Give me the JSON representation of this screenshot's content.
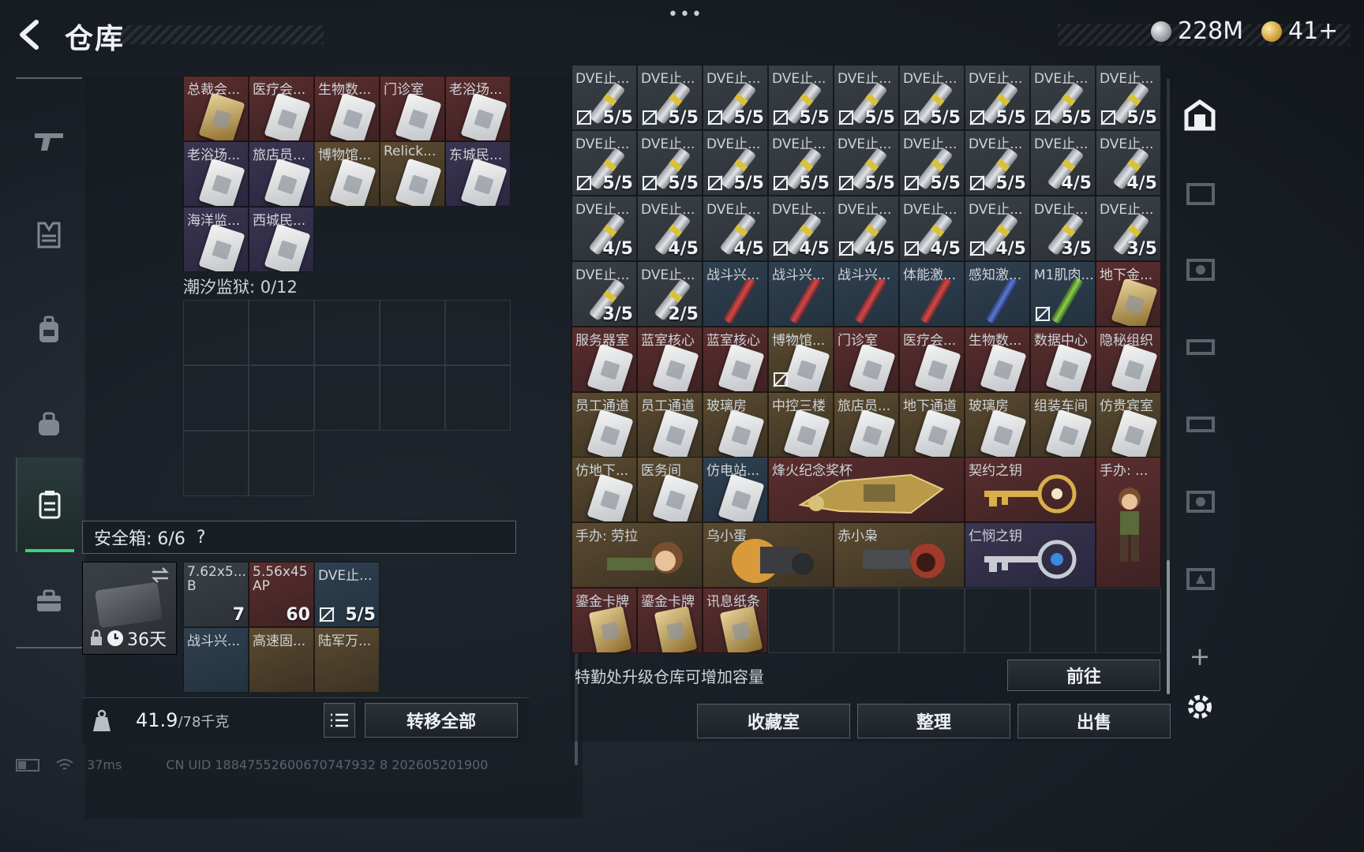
{
  "header": {
    "title": "仓库",
    "dots": "•••",
    "currency_silver": "228M",
    "currency_gold": "41+"
  },
  "left_nav": [
    "weapon-icon",
    "armor-icon",
    "backpack-icon",
    "bag-icon",
    "storage-icon",
    "briefcase-icon"
  ],
  "left_grid_top": [
    {
      "label": "总裁会...",
      "bg": "red",
      "item": "keycard-gold"
    },
    {
      "label": "医疗会...",
      "bg": "red",
      "item": "keycard"
    },
    {
      "label": "生物数...",
      "bg": "red",
      "item": "keycard"
    },
    {
      "label": "门诊室",
      "bg": "red",
      "item": "keycard"
    },
    {
      "label": "老浴场...",
      "bg": "red",
      "item": "keycard"
    },
    {
      "label": "老浴场...",
      "bg": "purple",
      "item": "keycard"
    },
    {
      "label": "旅店员...",
      "bg": "purple",
      "item": "keycard"
    },
    {
      "label": "博物馆...",
      "bg": "gold",
      "item": "keycard"
    },
    {
      "label": "Relick...",
      "bg": "gold",
      "item": "keycard"
    },
    {
      "label": "东城民...",
      "bg": "purple",
      "item": "keycard"
    },
    {
      "label": "海洋监...",
      "bg": "purple",
      "item": "keycard"
    },
    {
      "label": "西城民...",
      "bg": "purple",
      "item": "keycard"
    }
  ],
  "tide_prison_label": "潮汐监狱: 0/12",
  "safe_box": {
    "label": "安全箱: 6/6",
    "help": "?",
    "days": "36天",
    "items": [
      {
        "label": "7.62x5...",
        "sub": "B",
        "count": "7",
        "bg": "gray"
      },
      {
        "label": "5.56x45",
        "sub": "AP",
        "count": "60",
        "bg": "red"
      },
      {
        "label": "DVE止...",
        "count": "5/5",
        "bg": "blue",
        "bound": true
      },
      {
        "label": "战斗兴...",
        "count": "",
        "bg": "blue"
      },
      {
        "label": "高速固...",
        "count": "",
        "bg": "gold"
      },
      {
        "label": "陆军万...",
        "count": "",
        "bg": "gold"
      }
    ]
  },
  "weight": {
    "value": "41.9",
    "max": "/78千克"
  },
  "buttons": {
    "transfer_all": "转移全部",
    "goto": "前往",
    "collection": "收藏室",
    "sort": "整理",
    "sell": "出售"
  },
  "hint": "特勤处升级仓库可增加容量",
  "right_grid": [
    {
      "label": "DVE止...",
      "count": "5/5",
      "bg": "gray",
      "item": "injector",
      "bound": true
    },
    {
      "label": "DVE止...",
      "count": "5/5",
      "bg": "gray",
      "item": "injector",
      "bound": true
    },
    {
      "label": "DVE止...",
      "count": "5/5",
      "bg": "gray",
      "item": "injector",
      "bound": true
    },
    {
      "label": "DVE止...",
      "count": "5/5",
      "bg": "gray",
      "item": "injector",
      "bound": true
    },
    {
      "label": "DVE止...",
      "count": "5/5",
      "bg": "gray",
      "item": "injector",
      "bound": true
    },
    {
      "label": "DVE止...",
      "count": "5/5",
      "bg": "gray",
      "item": "injector",
      "bound": true
    },
    {
      "label": "DVE止...",
      "count": "5/5",
      "bg": "gray",
      "item": "injector",
      "bound": true
    },
    {
      "label": "DVE止...",
      "count": "5/5",
      "bg": "gray",
      "item": "injector",
      "bound": true
    },
    {
      "label": "DVE止...",
      "count": "5/5",
      "bg": "gray",
      "item": "injector",
      "bound": true
    },
    {
      "label": "DVE止...",
      "count": "5/5",
      "bg": "gray",
      "item": "injector",
      "bound": true
    },
    {
      "label": "DVE止...",
      "count": "5/5",
      "bg": "gray",
      "item": "injector",
      "bound": true
    },
    {
      "label": "DVE止...",
      "count": "5/5",
      "bg": "gray",
      "item": "injector",
      "bound": true
    },
    {
      "label": "DVE止...",
      "count": "5/5",
      "bg": "gray",
      "item": "injector",
      "bound": true
    },
    {
      "label": "DVE止...",
      "count": "5/5",
      "bg": "gray",
      "item": "injector",
      "bound": true
    },
    {
      "label": "DVE止...",
      "count": "5/5",
      "bg": "gray",
      "item": "injector",
      "bound": true
    },
    {
      "label": "DVE止...",
      "count": "5/5",
      "bg": "gray",
      "item": "injector",
      "bound": true
    },
    {
      "label": "DVE止...",
      "count": "4/5",
      "bg": "gray",
      "item": "injector",
      "bound": false
    },
    {
      "label": "DVE止...",
      "count": "4/5",
      "bg": "gray",
      "item": "injector",
      "bound": false
    },
    {
      "label": "DVE止...",
      "count": "4/5",
      "bg": "gray",
      "item": "injector",
      "bound": false
    },
    {
      "label": "DVE止...",
      "count": "4/5",
      "bg": "gray",
      "item": "injector",
      "bound": false
    },
    {
      "label": "DVE止...",
      "count": "4/5",
      "bg": "gray",
      "item": "injector",
      "bound": false
    },
    {
      "label": "DVE止...",
      "count": "4/5",
      "bg": "gray",
      "item": "injector",
      "bound": true
    },
    {
      "label": "DVE止...",
      "count": "4/5",
      "bg": "gray",
      "item": "injector",
      "bound": true
    },
    {
      "label": "DVE止...",
      "count": "4/5",
      "bg": "gray",
      "item": "injector",
      "bound": true
    },
    {
      "label": "DVE止...",
      "count": "4/5",
      "bg": "gray",
      "item": "injector",
      "bound": true
    },
    {
      "label": "DVE止...",
      "count": "3/5",
      "bg": "gray",
      "item": "injector",
      "bound": false
    },
    {
      "label": "DVE止...",
      "count": "3/5",
      "bg": "gray",
      "item": "injector",
      "bound": false
    },
    {
      "label": "DVE止...",
      "count": "3/5",
      "bg": "gray",
      "item": "injector",
      "bound": false
    },
    {
      "label": "DVE止...",
      "count": "2/5",
      "bg": "gray",
      "item": "injector",
      "bound": false
    },
    {
      "label": "战斗兴...",
      "count": "",
      "bg": "blue",
      "item": "stim"
    },
    {
      "label": "战斗兴...",
      "count": "",
      "bg": "blue",
      "item": "stim"
    },
    {
      "label": "战斗兴...",
      "count": "",
      "bg": "blue",
      "item": "stim"
    },
    {
      "label": "体能激...",
      "count": "",
      "bg": "blue",
      "item": "stim"
    },
    {
      "label": "感知激...",
      "count": "",
      "bg": "blue",
      "item": "stim-blue"
    },
    {
      "label": "M1肌肉...",
      "count": "",
      "bg": "blue",
      "item": "stim-green",
      "bound": true
    },
    {
      "label": "地下金...",
      "count": "",
      "bg": "red",
      "item": "keycard-gold"
    },
    {
      "label": "服务器室",
      "count": "",
      "bg": "red",
      "item": "keycard"
    },
    {
      "label": "蓝室核心",
      "count": "",
      "bg": "red",
      "item": "keycard"
    },
    {
      "label": "蓝室核心",
      "count": "",
      "bg": "red",
      "item": "keycard"
    },
    {
      "label": "博物馆...",
      "count": "",
      "bg": "gold",
      "item": "keycard",
      "bound": true
    },
    {
      "label": "门诊室",
      "count": "",
      "bg": "red",
      "item": "keycard"
    },
    {
      "label": "医疗会...",
      "count": "",
      "bg": "red",
      "item": "keycard"
    },
    {
      "label": "生物数...",
      "count": "",
      "bg": "red",
      "item": "keycard"
    },
    {
      "label": "数据中心",
      "count": "",
      "bg": "red",
      "item": "keycard"
    },
    {
      "label": "隐秘组织",
      "count": "",
      "bg": "red",
      "item": "keycard"
    },
    {
      "label": "员工通道",
      "count": "",
      "bg": "gold",
      "item": "keycard"
    },
    {
      "label": "员工通道",
      "count": "",
      "bg": "gold",
      "item": "keycard"
    },
    {
      "label": "玻璃房",
      "count": "",
      "bg": "gold",
      "item": "keycard"
    },
    {
      "label": "中控三楼",
      "count": "",
      "bg": "gold",
      "item": "keycard"
    },
    {
      "label": "旅店员...",
      "count": "",
      "bg": "gold",
      "item": "keycard"
    },
    {
      "label": "地下通道",
      "count": "",
      "bg": "gold",
      "item": "keycard"
    },
    {
      "label": "玻璃房",
      "count": "",
      "bg": "gold",
      "item": "keycard"
    },
    {
      "label": "组装车间",
      "count": "",
      "bg": "gold",
      "item": "keycard"
    },
    {
      "label": "仿贵宾室",
      "count": "",
      "bg": "gold",
      "item": "keycard"
    }
  ],
  "right_row7": [
    {
      "label": "仿地下...",
      "bg": "gold",
      "item": "keycard"
    },
    {
      "label": "医务间",
      "bg": "gold",
      "item": "keycard"
    },
    {
      "label": "仿电站...",
      "bg": "blue",
      "item": "keycard"
    }
  ],
  "big_items": [
    {
      "label": "烽火纪念奖杯",
      "name": "trophy-item"
    },
    {
      "label": "契约之钥",
      "name": "contract-key-item"
    },
    {
      "label": "手办: ...",
      "name": "figure-item"
    },
    {
      "label": "手办: 劳拉",
      "name": "figure-lara-item"
    },
    {
      "label": "乌小蛋",
      "name": "egg-item"
    },
    {
      "label": "赤小枭",
      "name": "owl-item"
    },
    {
      "label": "仁悯之钥",
      "name": "mercy-key-item"
    }
  ],
  "right_row9": [
    {
      "label": "鎏金卡牌",
      "bg": "red"
    },
    {
      "label": "鎏金卡牌",
      "bg": "red"
    },
    {
      "label": "讯息纸条",
      "bg": "red"
    }
  ],
  "status_bar": {
    "ping": "37ms",
    "uid": "CN UID 18847552600670747932 8 202605201900"
  },
  "colors": {
    "accent_green": "#37d27c"
  }
}
